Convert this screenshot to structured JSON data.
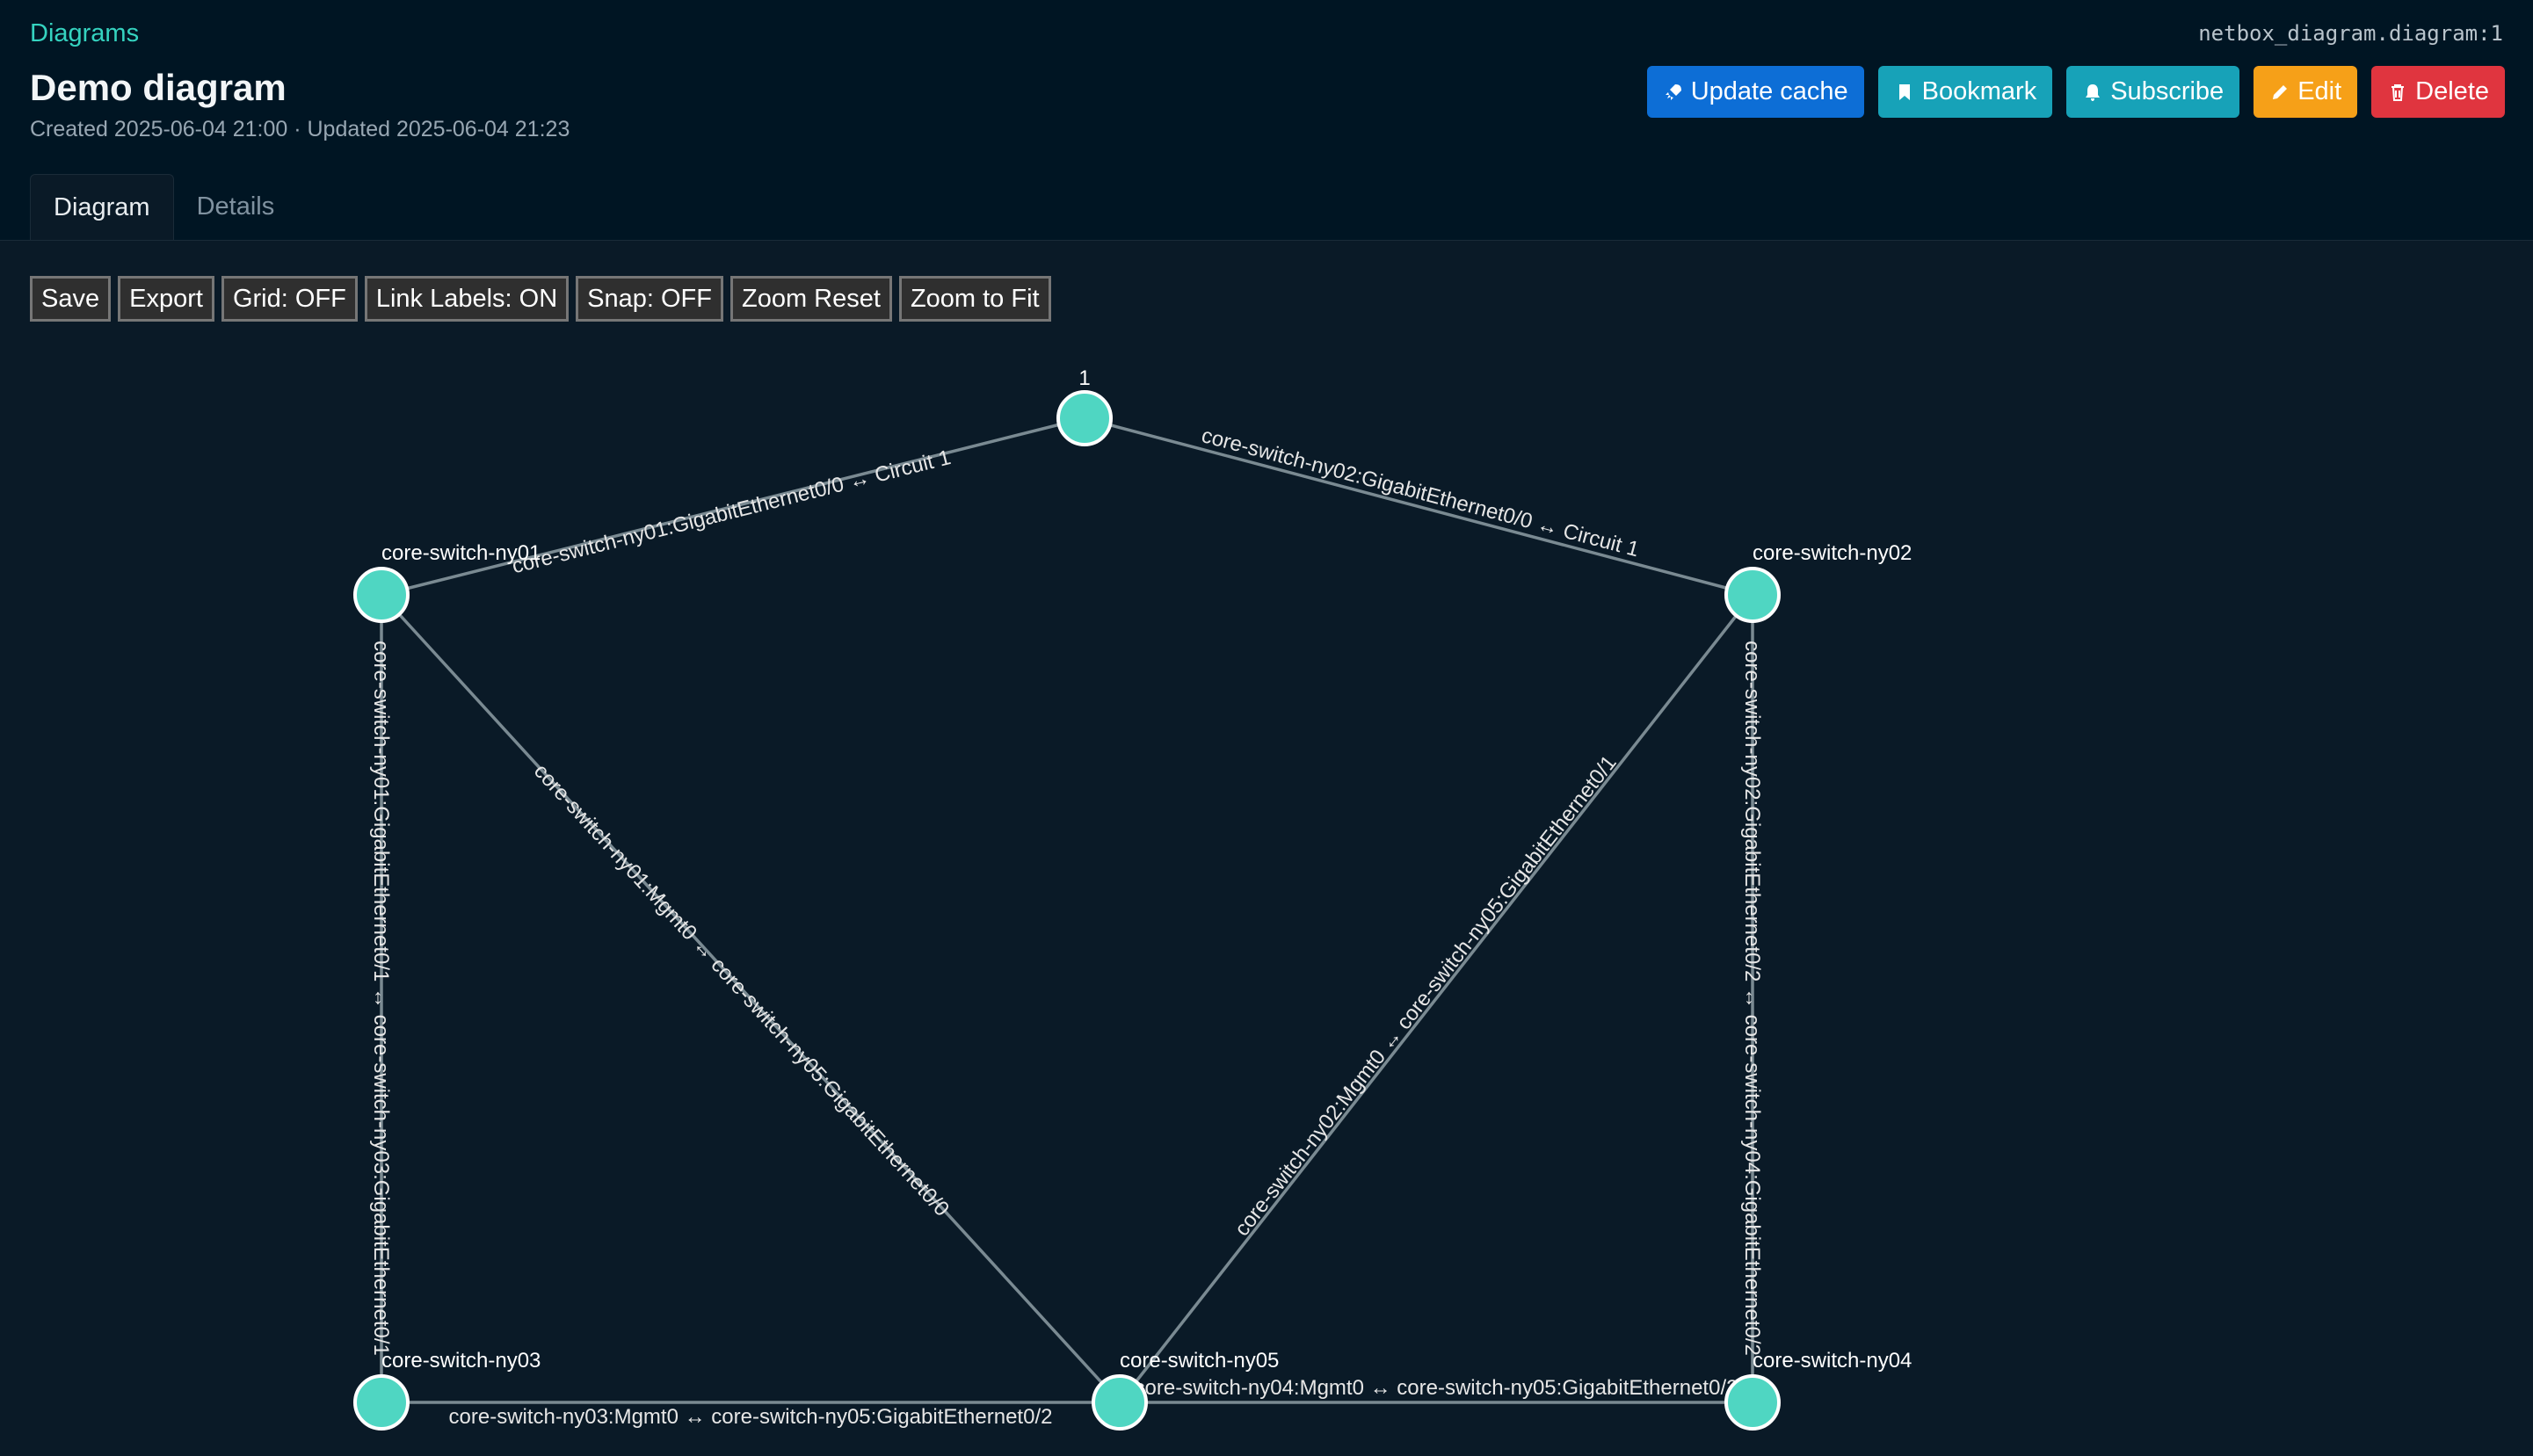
{
  "breadcrumb": "Diagrams",
  "object_id": "netbox_diagram.diagram:1",
  "title": "Demo diagram",
  "subtitle": "Created 2025-06-04 21:00 · Updated 2025-06-04 21:23",
  "actions": {
    "update_cache": "Update cache",
    "bookmark": "Bookmark",
    "subscribe": "Subscribe",
    "edit": "Edit",
    "delete": "Delete"
  },
  "tabs": [
    {
      "label": "Diagram",
      "active": true
    },
    {
      "label": "Details",
      "active": false
    }
  ],
  "toolbar": {
    "save": "Save",
    "export": "Export",
    "grid": "Grid: OFF",
    "link_labels": "Link Labels: ON",
    "snap": "Snap: OFF",
    "zoom_reset": "Zoom Reset",
    "zoom_fit": "Zoom to Fit"
  },
  "colors": {
    "accent": "#35d3c0",
    "node_fill": "#4fd6c2",
    "background": "#0a1a27",
    "update_cache": "#0d6ed6",
    "bookmark": "#17a2b8",
    "subscribe": "#17a2b8",
    "edit": "#f6a018",
    "delete": "#e0353f"
  },
  "diagram": {
    "nodes": [
      {
        "id": "circuit1",
        "label": "1"
      },
      {
        "id": "ny01",
        "label": "core-switch-ny01"
      },
      {
        "id": "ny02",
        "label": "core-switch-ny02"
      },
      {
        "id": "ny03",
        "label": "core-switch-ny03"
      },
      {
        "id": "ny05",
        "label": "core-switch-ny05"
      },
      {
        "id": "ny04",
        "label": "core-switch-ny04"
      }
    ],
    "links": [
      {
        "source": "ny01",
        "target": "circuit1",
        "label": "core-switch-ny01:GigabitEthernet0/0 ↔ Circuit 1"
      },
      {
        "source": "circuit1",
        "target": "ny02",
        "label": "core-switch-ny02:GigabitEthernet0/0 ↔ Circuit 1"
      },
      {
        "source": "ny01",
        "target": "ny03",
        "label": "core-switch-ny01:GigabitEthernet0/1 ↔ core-switch-ny03:GigabitEthernet0/1"
      },
      {
        "source": "ny01",
        "target": "ny05",
        "label": "core-switch-ny01:Mgmt0 ↔ core-switch-ny05:GigabitEthernet0/0"
      },
      {
        "source": "ny05",
        "target": "ny02",
        "label": "core-switch-ny02:Mgmt0 ↔ core-switch-ny05:GigabitEthernet0/1"
      },
      {
        "source": "ny02",
        "target": "ny04",
        "label": "core-switch-ny02:GigabitEthernet0/2 ↔ core-switch-ny04:GigabitEthernet0/2"
      },
      {
        "source": "ny03",
        "target": "ny05",
        "label": "core-switch-ny03:Mgmt0 ↔ core-switch-ny05:GigabitEthernet0/2"
      },
      {
        "source": "ny05",
        "target": "ny04",
        "label": "core-switch-ny04:Mgmt0 ↔ core-switch-ny05:GigabitEthernet0/2"
      }
    ]
  }
}
